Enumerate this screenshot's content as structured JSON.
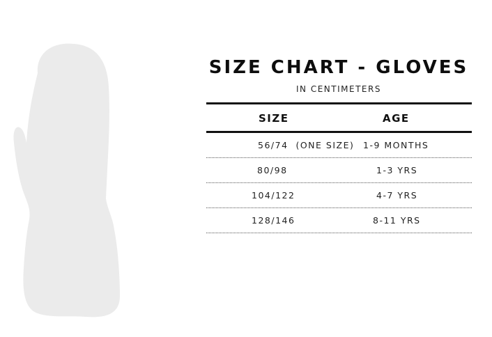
{
  "colors": {
    "mitten": "#ebebeb",
    "text": "#111111",
    "rule": "#111111"
  },
  "illustration": {
    "icon": "mitten-icon"
  },
  "title": "SIZE CHART - GLOVES",
  "subtitle": "IN CENTIMETERS",
  "table": {
    "headers": {
      "size": "SIZE",
      "age": "AGE"
    },
    "rows": [
      {
        "size": "56/74  (ONE SIZE)",
        "age": "1-9 MONTHS"
      },
      {
        "size": "80/98",
        "age": "1-3 YRS"
      },
      {
        "size": "104/122",
        "age": "4-7 YRS"
      },
      {
        "size": "128/146",
        "age": "8-11 YRS"
      }
    ]
  }
}
